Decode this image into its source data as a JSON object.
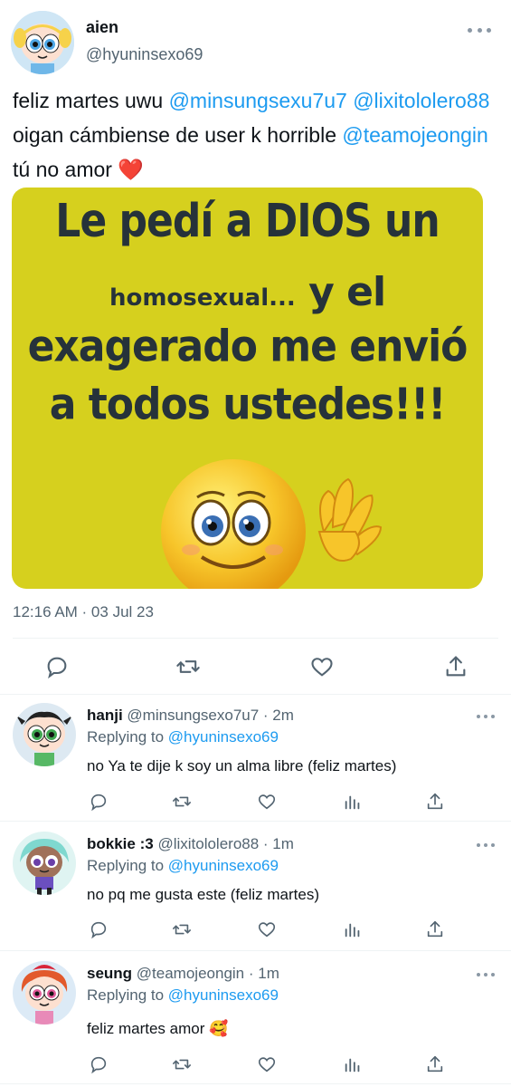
{
  "main_tweet": {
    "author_name": "aien",
    "author_handle": "@hyuninsexo69",
    "text_1": "feliz martes uwu ",
    "mention_1": "@minsungsexu7u7",
    "mention_2": "@lixitololero88",
    "text_2": " oigan cámbiense de user k horrible ",
    "mention_3": "@teamojeongin",
    "text_3": " tú no amor ❤️",
    "image": {
      "line1": "Le pedí a DIOS un",
      "line2_small": "homosexual...",
      "line2_big": " y el",
      "line3": "exagerado me envió",
      "line4": "a todos ustedes!!!"
    },
    "timestamp": "12:16 AM · 03 Jul 23"
  },
  "replies": [
    {
      "name": "hanji",
      "handle": "@minsungsexo7u7 · 2m",
      "replying_label": "Replying to ",
      "replying_to": "@hyuninsexo69",
      "text": "no Ya te dije k soy un alma libre (feliz martes)"
    },
    {
      "name": "bokkie :3",
      "handle": "@lixitololero88 · 1m",
      "replying_label": "Replying to ",
      "replying_to": "@hyuninsexo69",
      "text": "no pq me gusta este (feliz martes)"
    },
    {
      "name": "seung",
      "handle": "@teamojeongin · 1m",
      "replying_label": "Replying to ",
      "replying_to": "@hyuninsexo69",
      "text": "feliz martes amor 🥰"
    }
  ],
  "colors": {
    "accent": "#1d9bf0",
    "secondary_text": "#536471",
    "icon": "#536471",
    "meme_background": "#d6d01e"
  },
  "icons": [
    "reply-icon",
    "retweet-icon",
    "like-icon",
    "share-icon",
    "analytics-icon",
    "more-icon"
  ]
}
